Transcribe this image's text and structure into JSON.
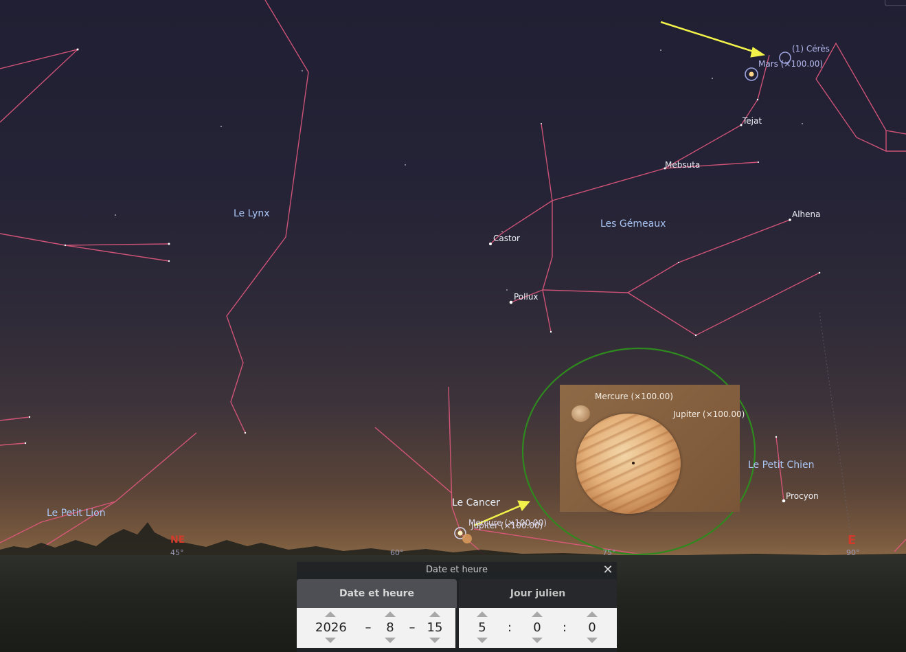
{
  "constellations": {
    "lynx": "Le Lynx",
    "gemini": "Les Gémeaux",
    "cancer": "Le Cancer",
    "leo_minor": "Le Petit Lion",
    "canis_minor": "Le Petit Chien"
  },
  "stars": {
    "tejat": "Tejat",
    "mebsuta": "Mebsuta",
    "alhena": "Alhena",
    "castor": "Castor",
    "pollux": "Pollux",
    "procyon": "Procyon"
  },
  "planets": {
    "ceres": "(1) Cérès",
    "mars": "Mars (×100.00)",
    "mercury": "Mercure (×100.00)",
    "jupiter": "Jupiter (×100.00)"
  },
  "inset": {
    "mercury": "Mercure (×100.00)",
    "jupiter": "Jupiter (×100.00)"
  },
  "horizon": {
    "ne": "NE",
    "e": "E",
    "az45": "45°",
    "az60": "60°",
    "az75": "75°",
    "az90": "90°"
  },
  "colors": {
    "constellation_lines": "#e0587e",
    "highlight_arrow": "#f2f24a",
    "highlight_circle": "#2e8a1e",
    "cardinal": "#d23a2a"
  },
  "dialog": {
    "title": "Date et heure",
    "close_icon": "close-icon",
    "tabs": [
      "Date et heure",
      "Jour julien"
    ],
    "active_tab": "Date et heure",
    "date": {
      "year": "2026",
      "month": "8",
      "day": "15",
      "sep": "–"
    },
    "time": {
      "hour": "5",
      "minute": "0",
      "second": "0",
      "sep": ":"
    }
  }
}
